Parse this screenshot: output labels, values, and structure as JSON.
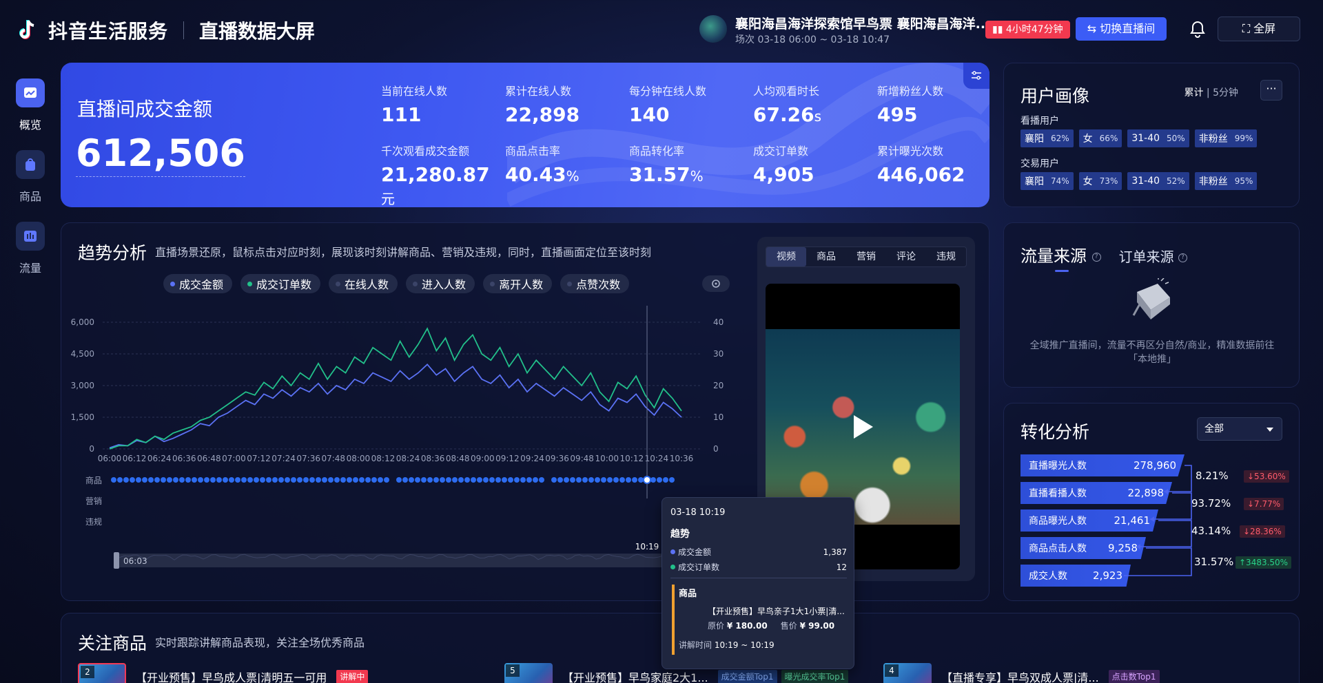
{
  "header": {
    "brand": "抖音生活服务",
    "subtitle": "直播数据大屏",
    "room_title": "襄阳海昌海洋探索馆早鸟票 襄阳海昌海洋...",
    "room_time": "场次 03-18 06:00 ~ 03-18 10:47",
    "duration_badge": "4小时47分钟",
    "switch_label": "⇆ 切换直播间",
    "fullscreen_label": "⛶ 全屏"
  },
  "nav": [
    {
      "label": "概览",
      "icon": "overview-chart-icon"
    },
    {
      "label": "商品",
      "icon": "shopping-bag-icon"
    },
    {
      "label": "流量",
      "icon": "traffic-bars-icon"
    }
  ],
  "hero": {
    "title": "直播间成交金额",
    "value": "612,506",
    "metrics": [
      {
        "label": "当前在线人数",
        "value": "111",
        "unit": ""
      },
      {
        "label": "累计在线人数",
        "value": "22,898",
        "unit": ""
      },
      {
        "label": "每分钟在线人数",
        "value": "140",
        "unit": ""
      },
      {
        "label": "人均观看时长",
        "value": "67.26",
        "unit": "s"
      },
      {
        "label": "新增粉丝人数",
        "value": "495",
        "unit": ""
      },
      {
        "label": "千次观看成交金额",
        "value": "21,280.87",
        "unit": "元"
      },
      {
        "label": "商品点击率",
        "value": "40.43",
        "unit": "%"
      },
      {
        "label": "商品转化率",
        "value": "31.57",
        "unit": "%"
      },
      {
        "label": "成交订单数",
        "value": "4,905",
        "unit": ""
      },
      {
        "label": "累计曝光次数",
        "value": "446,062",
        "unit": ""
      }
    ]
  },
  "user_profile": {
    "title": "用户画像",
    "toggle_active": "累计",
    "toggle_other": "5分钟",
    "more": "···",
    "viewers_label": "看播用户",
    "viewers": [
      {
        "k": "襄阳",
        "v": "62%"
      },
      {
        "k": "女",
        "v": "66%"
      },
      {
        "k": "31-40",
        "v": "50%"
      },
      {
        "k": "非粉丝",
        "v": "99%"
      }
    ],
    "buyers_label": "交易用户",
    "buyers": [
      {
        "k": "襄阳",
        "v": "74%"
      },
      {
        "k": "女",
        "v": "73%"
      },
      {
        "k": "31-40",
        "v": "52%"
      },
      {
        "k": "非粉丝",
        "v": "95%"
      }
    ]
  },
  "trend": {
    "title": "趋势分析",
    "desc": "直播场景还原，鼠标点击对应时刻，展现该时刻讲解商品、营销及违规，同时，直播画面定位至该时刻",
    "legend": [
      {
        "label": "成交金额",
        "color": "#5b72f5"
      },
      {
        "label": "成交订单数",
        "color": "#22c08a"
      },
      {
        "label": "在线人数",
        "color": "#3b4468"
      },
      {
        "label": "进入人数",
        "color": "#3b4468"
      },
      {
        "label": "离开人数",
        "color": "#3b4468"
      },
      {
        "label": "点赞次数",
        "color": "#3b4468"
      }
    ],
    "row_labels": [
      "商品",
      "营销",
      "违规"
    ],
    "slider_start": "06:03",
    "slider_end": "10:19"
  },
  "chart_data": {
    "type": "line",
    "x_ticks": [
      "06:00",
      "06:12",
      "06:24",
      "06:36",
      "06:48",
      "07:00",
      "07:12",
      "07:24",
      "07:36",
      "07:48",
      "08:00",
      "08:12",
      "08:24",
      "08:36",
      "08:48",
      "09:00",
      "09:12",
      "09:24",
      "09:36",
      "09:48",
      "10:00",
      "10:12",
      "10:24",
      "10:36"
    ],
    "y_left_ticks": [
      "6,000",
      "4,500",
      "3,000",
      "1,500",
      "0"
    ],
    "y_right_ticks": [
      "40",
      "30",
      "20",
      "10",
      "0"
    ],
    "ylim_left": [
      0,
      6000
    ],
    "ylim_right": [
      0,
      40
    ],
    "series": [
      {
        "name": "成交金额",
        "axis": "left",
        "color": "#5b72f5",
        "values": [
          50,
          200,
          150,
          400,
          300,
          600,
          350,
          500,
          700,
          900,
          1200,
          1100,
          1500,
          1700,
          2000,
          2300,
          2100,
          2600,
          2400,
          2800,
          2500,
          2900,
          2700,
          3100,
          2600,
          3000,
          2800,
          3300,
          3100,
          3600,
          3400,
          3200,
          3700,
          3300,
          3600,
          4000,
          3500,
          3800,
          3200,
          3600,
          3900,
          3300,
          3100,
          3500,
          2900,
          3300,
          2700,
          3100,
          2800,
          2500,
          2900,
          2600,
          2300,
          2700,
          2100,
          1800,
          2400,
          2200,
          2600,
          2000,
          1600,
          2200,
          1900,
          1500
        ]
      },
      {
        "name": "成交订单数",
        "axis": "right",
        "color": "#22c08a",
        "values": [
          0,
          1,
          1,
          3,
          2,
          4,
          3,
          5,
          6,
          7,
          9,
          10,
          12,
          14,
          16,
          18,
          17,
          21,
          19,
          23,
          20,
          24,
          22,
          27,
          22,
          26,
          24,
          29,
          27,
          32,
          30,
          28,
          34,
          29,
          33,
          38,
          31,
          35,
          28,
          33,
          36,
          30,
          28,
          32,
          26,
          30,
          24,
          28,
          25,
          22,
          26,
          23,
          20,
          24,
          18,
          15,
          21,
          19,
          23,
          17,
          13,
          19,
          16,
          12
        ]
      }
    ],
    "grid": true,
    "cursor_x": "10:19"
  },
  "video_tabs": [
    "视频",
    "商品",
    "营销",
    "评论",
    "违规"
  ],
  "tooltip": {
    "time": "03-18 10:19",
    "section": "趋势",
    "rows": [
      {
        "label": "成交金额",
        "value": "1,387",
        "color": "#5b72f5"
      },
      {
        "label": "成交订单数",
        "value": "12",
        "color": "#22c08a"
      }
    ],
    "goods_title": "商品",
    "goods_name": "【开业预售】早鸟亲子1大1小票|清...",
    "orig_label": "原价",
    "orig_price": "¥ 180.00",
    "sale_label": "售价",
    "sale_price": "¥ 99.00",
    "span_label": "讲解时间",
    "span_value": "10:19 ~ 10:19"
  },
  "traffic": {
    "tab_active": "流量来源",
    "tab_other": "订单来源",
    "empty_text": "全域推广直播间，流量不再区分自然/商业，精准数据前往「本地推」"
  },
  "conversion": {
    "title": "转化分析",
    "select_value": "全部",
    "steps": [
      {
        "label": "直播曝光人数",
        "value": "278,960"
      },
      {
        "label": "直播看播人数",
        "value": "22,898"
      },
      {
        "label": "商品曝光人数",
        "value": "21,461"
      },
      {
        "label": "商品点击人数",
        "value": "9,258"
      },
      {
        "label": "成交人数",
        "value": "2,923"
      }
    ],
    "rates": [
      {
        "rate": "8.21%",
        "delta": "↓53.60%",
        "dir": "down"
      },
      {
        "rate": "93.72%",
        "delta": "↓7.77%",
        "dir": "down"
      },
      {
        "rate": "43.14%",
        "delta": "↓28.36%",
        "dir": "down"
      },
      {
        "rate": "31.57%",
        "delta": "↑3483.50%",
        "dir": "up"
      }
    ]
  },
  "focus": {
    "title": "关注商品",
    "desc": "实时跟踪讲解商品表现，关注全场优秀商品",
    "products": [
      {
        "rank": "2",
        "name": "【开业预售】早鸟成人票|清明五一可用",
        "tag": "讲解中",
        "tag_color": "#f2394f",
        "tag_bg": "#f2394f",
        "tag_fg": "#ffffff"
      },
      {
        "rank": "5",
        "name": "【开业预售】早鸟家庭2大1...",
        "tag": "成交金额Top1",
        "tag2": "曝光成交率Top1"
      },
      {
        "rank": "4",
        "name": "【直播专享】早鸟双成人票|清...",
        "tag": "点击数Top1"
      }
    ]
  }
}
